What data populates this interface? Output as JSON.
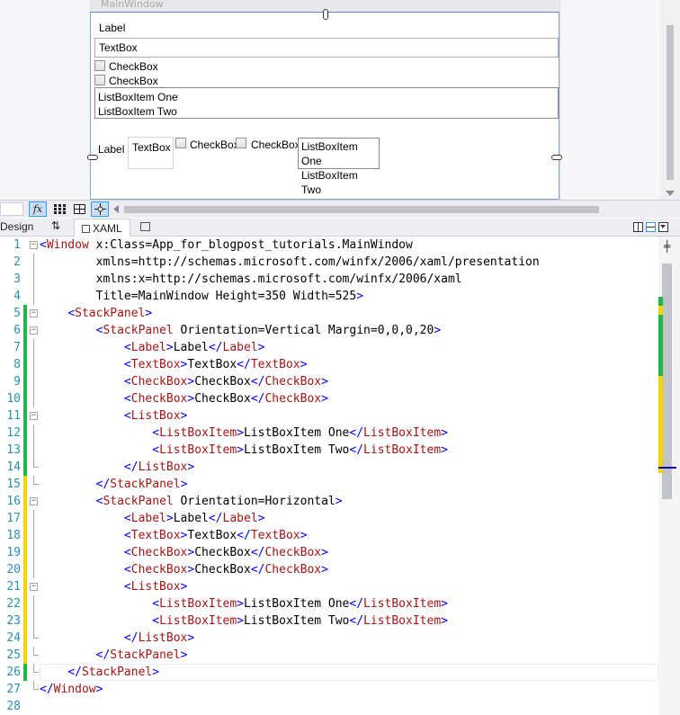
{
  "designer": {
    "window_title": "MainWindow",
    "vertical_panel": {
      "label": "Label",
      "textbox": "TextBox",
      "checkbox1": "CheckBox",
      "checkbox2": "CheckBox",
      "listbox_items": [
        "ListBoxItem One",
        "ListBoxItem Two"
      ]
    },
    "horizontal_panel": {
      "label": "Label",
      "textbox": "TextBox",
      "checkbox1": "CheckBox",
      "checkbox2": "CheckBox",
      "listbox_items": [
        "ListBoxItem One",
        "ListBoxItem Two"
      ]
    }
  },
  "toolbar": {
    "fx_label": "fx"
  },
  "tabs": {
    "design": "Design",
    "swap": "⇅",
    "xaml": "XAML"
  },
  "editor": {
    "line_numbers": [
      "1",
      "2",
      "3",
      "4",
      "5",
      "6",
      "7",
      "8",
      "9",
      "10",
      "11",
      "12",
      "13",
      "14",
      "15",
      "16",
      "17",
      "18",
      "19",
      "20",
      "21",
      "22",
      "23",
      "24",
      "25",
      "26",
      "27",
      "28"
    ],
    "lines": [
      "<Window x:Class=\"App_for_blogpost_tutorials.MainWindow\"",
      "        xmlns=\"http://schemas.microsoft.com/winfx/2006/xaml/presentation\"",
      "        xmlns:x=\"http://schemas.microsoft.com/winfx/2006/xaml\"",
      "        Title=\"MainWindow\" Height=\"350\" Width=\"525\">",
      "    <StackPanel>",
      "        <StackPanel Orientation=\"Vertical\" Margin=\"0,0,0,20\">",
      "            <Label>Label</Label>",
      "            <TextBox>TextBox</TextBox>",
      "            <CheckBox>CheckBox</CheckBox>",
      "            <CheckBox>CheckBox</CheckBox>",
      "            <ListBox>",
      "                <ListBoxItem>ListBoxItem One</ListBoxItem>",
      "                <ListBoxItem>ListBoxItem Two</ListBoxItem>",
      "            </ListBox>",
      "        </StackPanel>",
      "        <StackPanel Orientation=\"Horizontal\">",
      "            <Label>Label</Label>",
      "            <TextBox>TextBox</TextBox>",
      "            <CheckBox>CheckBox</CheckBox>",
      "            <CheckBox>CheckBox</CheckBox>",
      "            <ListBox>",
      "                <ListBoxItem>ListBoxItem One</ListBoxItem>",
      "                <ListBoxItem>ListBoxItem Two</ListBoxItem>",
      "            </ListBox>",
      "        </StackPanel>",
      "    </StackPanel>",
      "</Window>",
      ""
    ],
    "change_marks": [
      "",
      "",
      "",
      "",
      "green",
      "green",
      "green",
      "green",
      "green",
      "green",
      "green",
      "green",
      "green",
      "green",
      "yellow",
      "yellow",
      "yellow",
      "yellow",
      "yellow",
      "yellow",
      "yellow",
      "yellow",
      "yellow",
      "yellow",
      "yellow",
      "green",
      "",
      ""
    ],
    "fold_marks": [
      "open",
      "line",
      "line",
      "line",
      "open",
      "open",
      "line",
      "line",
      "line",
      "line",
      "open",
      "line",
      "line",
      "end",
      "end",
      "open",
      "line",
      "line",
      "line",
      "line",
      "open",
      "line",
      "line",
      "end",
      "end",
      "end",
      "end",
      ""
    ],
    "current_line": 26
  },
  "colors": {
    "tag": "#a31515",
    "attribute": "#ff0000",
    "punctuation": "#0000ff",
    "line_number": "#2b91af",
    "changed_saved": "#1fb74a",
    "changed_unsaved": "#f5d400",
    "selection_border": "#3399ff"
  }
}
